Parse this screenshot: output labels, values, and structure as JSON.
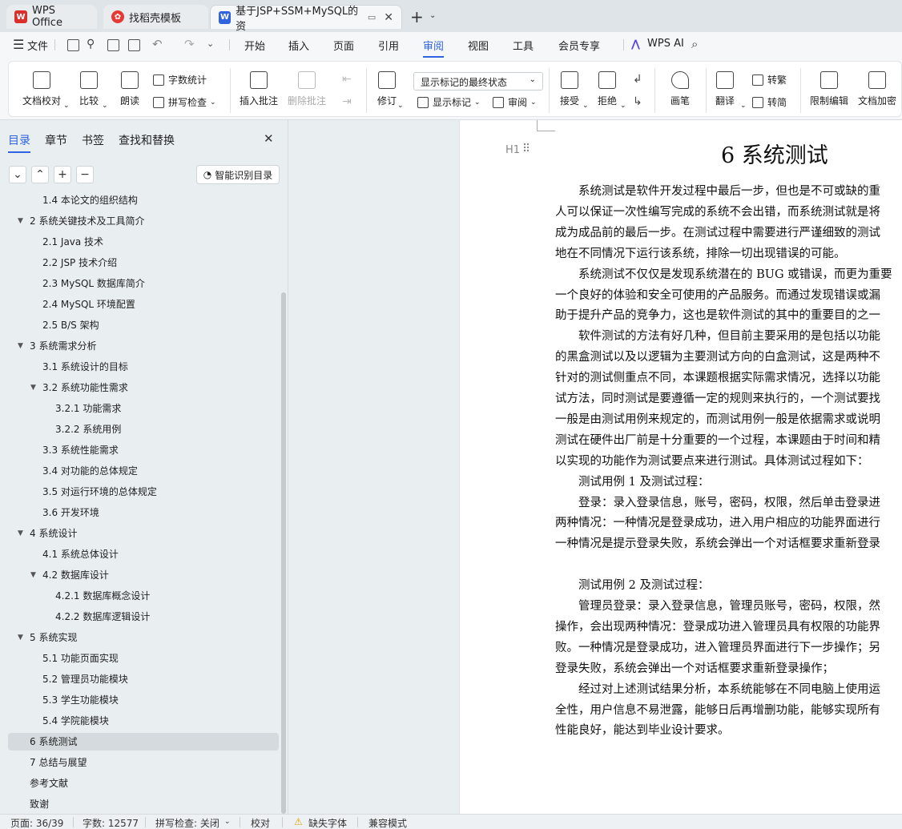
{
  "tabs": [
    {
      "label": "WPS Office"
    },
    {
      "label": "找稻壳模板"
    },
    {
      "label": "基于JSP+SSM+MySQL的资"
    }
  ],
  "menu": {
    "file": "文件",
    "items": [
      "开始",
      "插入",
      "页面",
      "引用",
      "审阅",
      "视图",
      "工具",
      "会员专享"
    ],
    "active": "审阅",
    "ai": "WPS AI"
  },
  "ribbon": {
    "doc_check": "文档校对",
    "compare": "比较",
    "read_aloud": "朗读",
    "word_count": "字数统计",
    "spell_check": "拼写检查",
    "insert_comment": "插入批注",
    "delete_comment": "删除批注",
    "revise": "修订",
    "markup_state": "显示标记的最终状态",
    "show_markup": "显示标记",
    "review": "审阅",
    "accept": "接受",
    "reject": "拒绝",
    "pen": "画笔",
    "translate": "翻译",
    "to_traditional": "转繁",
    "to_simplified": "转简",
    "restrict_edit": "限制编辑",
    "encrypt": "文档加密"
  },
  "panel": {
    "tabs": [
      "目录",
      "章节",
      "书签",
      "查找和替换"
    ],
    "active_tab": "目录",
    "smart_toc": "智能识别目录",
    "toc": [
      {
        "label": "1.4 本论文的组织结构",
        "level": 2
      },
      {
        "label": "2 系统关键技术及工具简介",
        "level": 1,
        "expanded": true
      },
      {
        "label": "2.1 Java 技术",
        "level": 2
      },
      {
        "label": "2.2 JSP 技术介绍",
        "level": 2
      },
      {
        "label": "2.3 MySQL 数据库简介",
        "level": 2
      },
      {
        "label": "2.4 MySQL 环境配置",
        "level": 2
      },
      {
        "label": "2.5 B/S 架构",
        "level": 2
      },
      {
        "label": "3 系统需求分析",
        "level": 1,
        "expanded": true
      },
      {
        "label": "3.1 系统设计的目标",
        "level": 2
      },
      {
        "label": "3.2 系统功能性需求",
        "level": 2,
        "expanded": true
      },
      {
        "label": "3.2.1  功能需求",
        "level": 3
      },
      {
        "label": "3.2.2  系统用例",
        "level": 3
      },
      {
        "label": "3.3 系统性能需求",
        "level": 2
      },
      {
        "label": "3.4 对功能的总体规定",
        "level": 2
      },
      {
        "label": "3.5 对运行环境的总体规定",
        "level": 2
      },
      {
        "label": "3.6 开发环境",
        "level": 2
      },
      {
        "label": "4 系统设计",
        "level": 1,
        "expanded": true
      },
      {
        "label": "4.1 系统总体设计",
        "level": 2
      },
      {
        "label": "4.2 数据库设计",
        "level": 2,
        "expanded": true
      },
      {
        "label": "4.2.1  数据库概念设计",
        "level": 3
      },
      {
        "label": "4.2.2  数据库逻辑设计",
        "level": 3
      },
      {
        "label": "5 系统实现",
        "level": 1,
        "expanded": true
      },
      {
        "label": "5.1 功能页面实现",
        "level": 2
      },
      {
        "label": "5.2 管理员功能模块",
        "level": 2
      },
      {
        "label": "5.3 学生功能模块",
        "level": 2
      },
      {
        "label": "5.4 学院能模块",
        "level": 2
      },
      {
        "label": "6 系统测试",
        "level": 1,
        "selected": true
      },
      {
        "label": "7 总结与展望",
        "level": 1
      },
      {
        "label": "参考文献",
        "level": 1
      },
      {
        "label": "致谢",
        "level": 1
      }
    ]
  },
  "document": {
    "heading_marker": "H1",
    "heading": "6 系统测试",
    "lines": [
      "　　系统测试是软件开发过程中最后一步，但也是不可或缺的重",
      "人可以保证一次性编写完成的系统不会出错，而系统测试就是将",
      "成为成品前的最后一步。在测试过程中需要进行严谨细致的测试",
      "地在不同情况下运行该系统，排除一切出现错误的可能。",
      "　　系统测试不仅仅是发现系统潜在的 BUG 或错误，而更为重要",
      "一个良好的体验和安全可使用的产品服务。而通过发现错误或漏",
      "助于提升产品的竞争力，这也是软件测试的其中的重要目的之一",
      "　　软件测试的方法有好几种，但目前主要采用的是包括以功能",
      "的黑盒测试以及以逻辑为主要测试方向的白盒测试，这是两种不",
      "针对的测试侧重点不同，本课题根据实际需求情况，选择以功能",
      "试方法，同时测试是要遵循一定的规则来执行的，一个测试要找",
      "一般是由测试用例来规定的，而测试用例一般是依据需求或说明",
      "测试在硬件出厂前是十分重要的一个过程，本课题由于时间和精",
      "以实现的功能作为测试要点来进行测试。具体测试过程如下：",
      "　　测试用例 1 及测试过程：",
      "　　登录：录入登录信息，账号，密码，权限，然后单击登录进",
      "两种情况：一种情况是登录成功，进入用户相应的功能界面进行",
      "一种情况是提示登录失败，系统会弹出一个对话框要求重新登录",
      "",
      "　　测试用例 2 及测试过程：",
      "　　管理员登录：录入登录信息，管理员账号，密码，权限，然",
      "操作，会出现两种情况：登录成功进入管理员具有权限的功能界",
      "败。一种情况是登录成功，进入管理员界面进行下一步操作；另",
      "登录失败，系统会弹出一个对话框要求重新登录操作；",
      "　　经过对上述测试结果分析，本系统能够在不同电脑上使用运",
      "全性，用户信息不易泄露，能够日后再增删功能，能够实现所有",
      "性能良好，能达到毕业设计要求。"
    ]
  },
  "status": {
    "page": "页面: 36/39",
    "words": "字数: 12577",
    "spell": "拼写检查: 关闭",
    "proof": "校对",
    "missing_font": "缺失字体",
    "compat": "兼容模式"
  },
  "colors": {
    "accent": "#2f63e0",
    "wps_red": "#d9302c",
    "doc_blue": "#2f63e0"
  }
}
